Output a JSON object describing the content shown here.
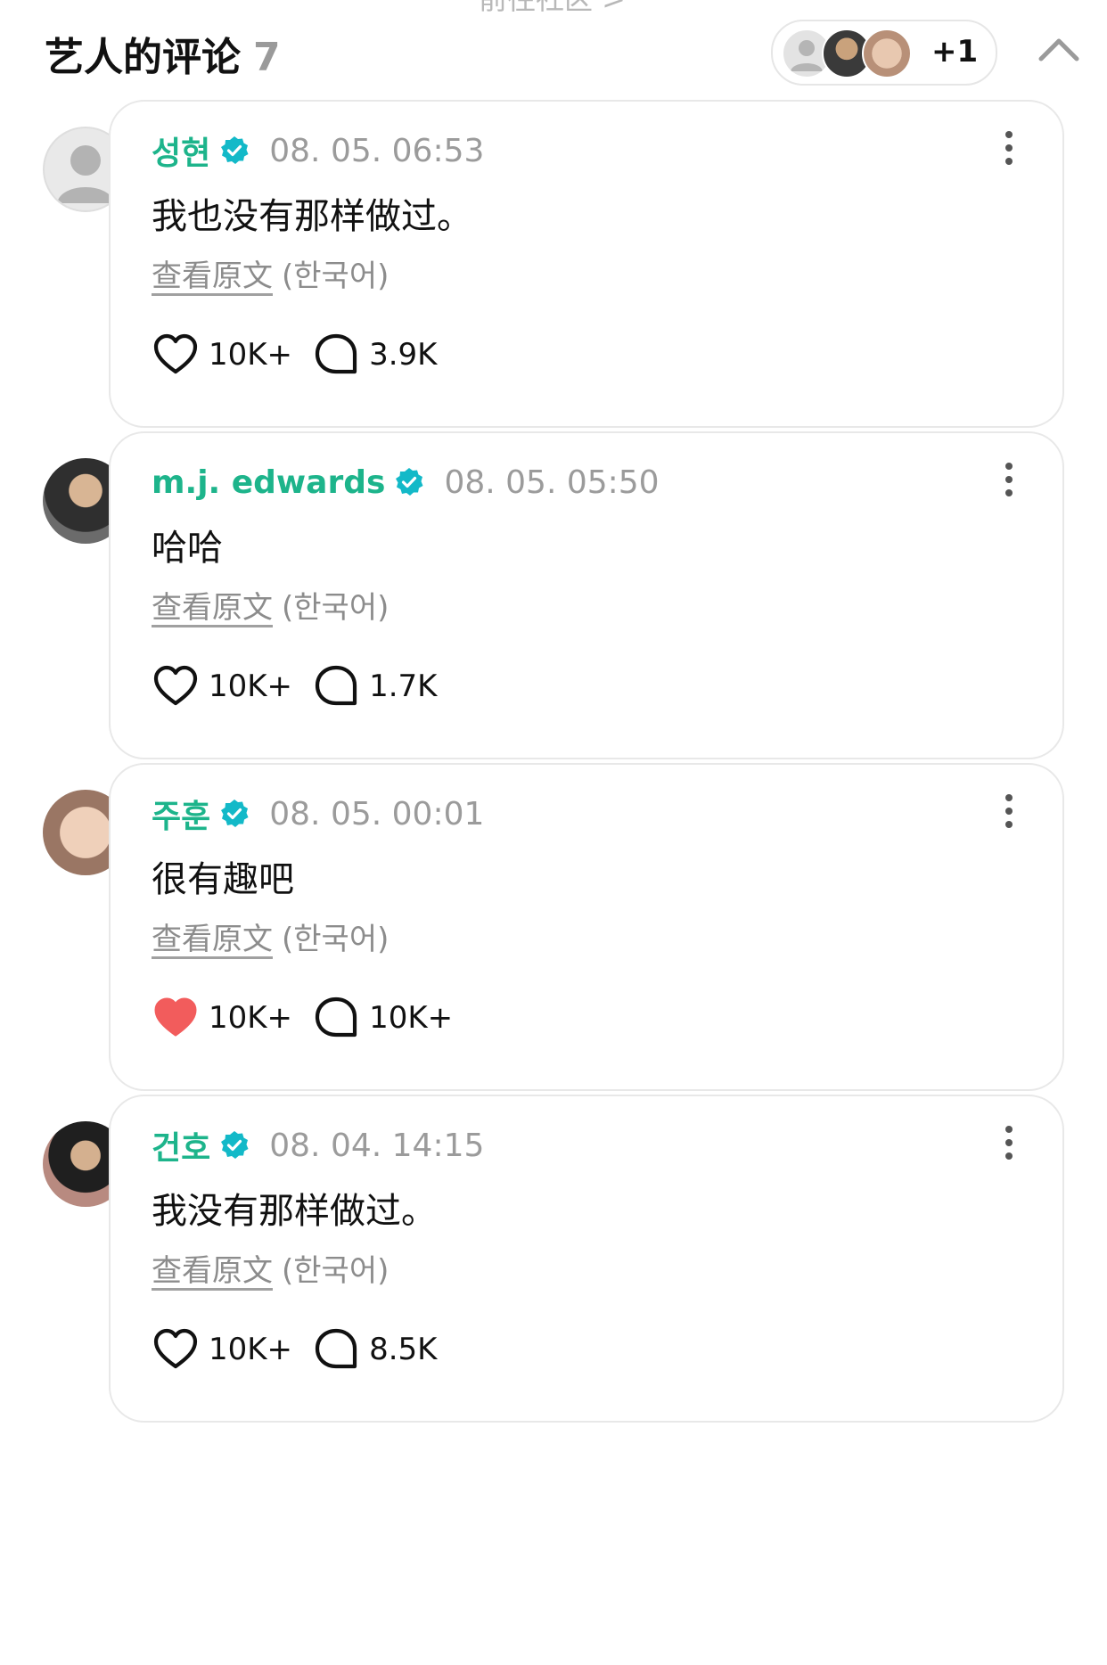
{
  "header": {
    "top_link": "前往社区 >",
    "title": "艺人的评论",
    "count": "7",
    "extra_artists": "+1"
  },
  "colors": {
    "accent": "#1db48b",
    "verified": "#13b9c8",
    "liked": "#f25c5c"
  },
  "comments": [
    {
      "author": "성현",
      "timestamp": "08. 05. 06:53",
      "text": "我也没有那样做过。",
      "view_original": "查看原文",
      "original_lang": "(한국어)",
      "likes": "10K+",
      "replies": "3.9K",
      "liked": false
    },
    {
      "author": "m.j. edwards",
      "timestamp": "08. 05. 05:50",
      "text": "哈哈",
      "view_original": "查看原文",
      "original_lang": "(한국어)",
      "likes": "10K+",
      "replies": "1.7K",
      "liked": false
    },
    {
      "author": "주훈",
      "timestamp": "08. 05. 00:01",
      "text": "很有趣吧",
      "view_original": "查看原文",
      "original_lang": "(한국어)",
      "likes": "10K+",
      "replies": "10K+",
      "liked": true
    },
    {
      "author": "건호",
      "timestamp": "08. 04. 14:15",
      "text": "我没有那样做过。",
      "view_original": "查看原文",
      "original_lang": "(한국어)",
      "likes": "10K+",
      "replies": "8.5K",
      "liked": false
    }
  ]
}
